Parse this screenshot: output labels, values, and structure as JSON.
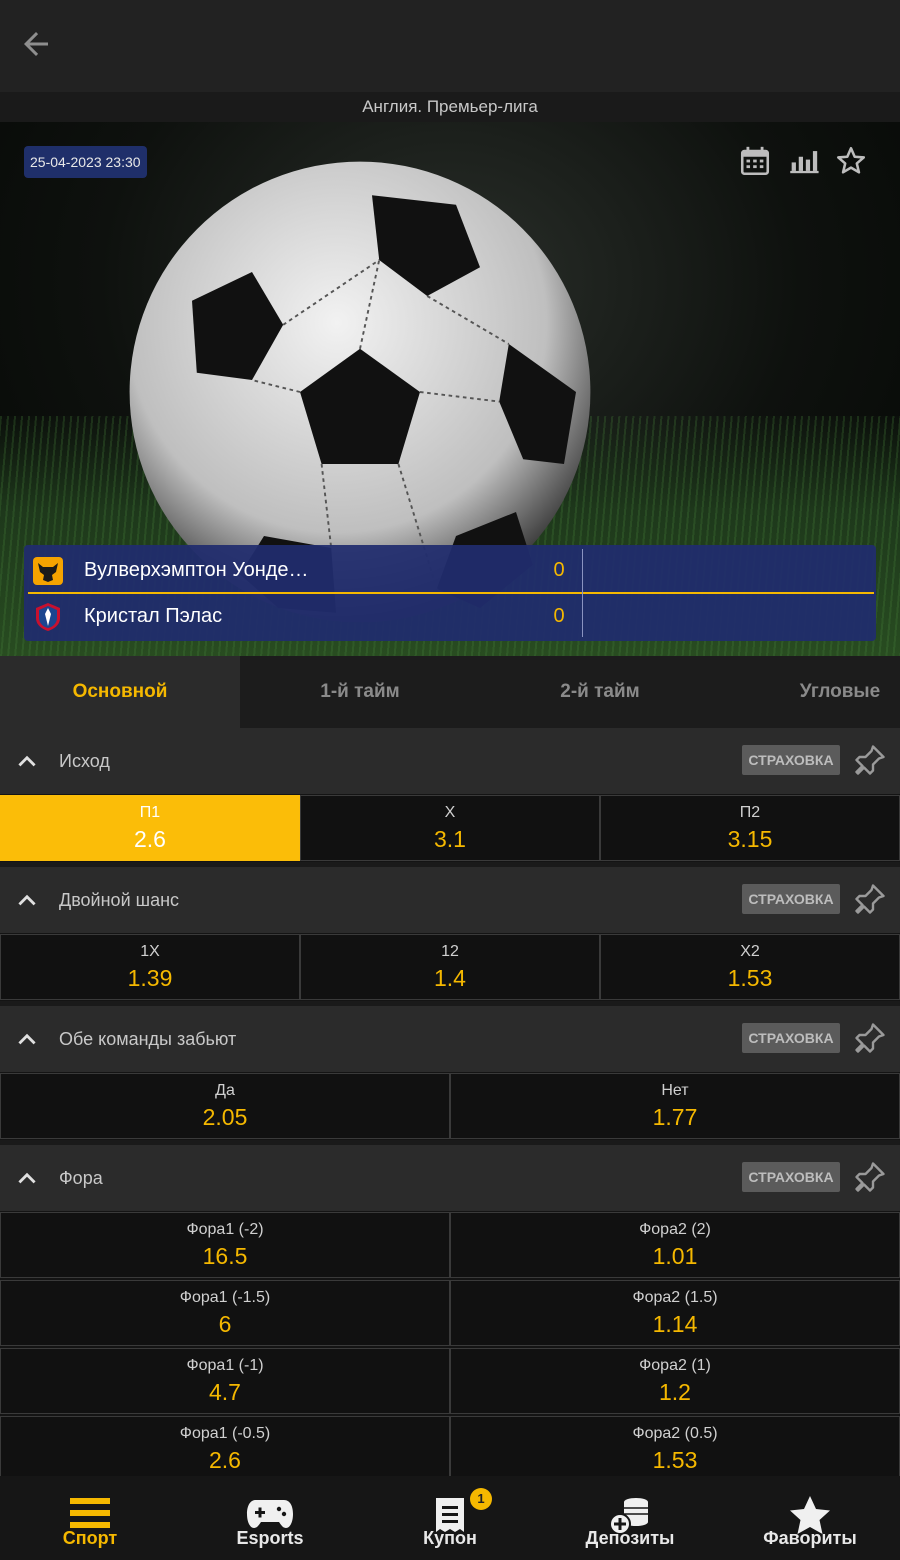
{
  "header": {
    "league": "Англия. Премьер-лига"
  },
  "event": {
    "datetime": "25-04-2023 23:30",
    "teams": [
      {
        "name": "Вулверхэмптон Уонде…",
        "score": "0"
      },
      {
        "name": "Кристал Пэлас",
        "score": "0"
      }
    ]
  },
  "tabs": [
    "Основной",
    "1-й тайм",
    "2-й тайм",
    "Угловые"
  ],
  "insurance_label": "СТРАХОВКА",
  "markets": [
    {
      "title": "Исход",
      "rows": [
        [
          {
            "label": "П1",
            "odd": "2.6"
          },
          {
            "label": "Х",
            "odd": "3.1"
          },
          {
            "label": "П2",
            "odd": "3.15"
          }
        ]
      ]
    },
    {
      "title": "Двойной шанс",
      "rows": [
        [
          {
            "label": "1Х",
            "odd": "1.39"
          },
          {
            "label": "12",
            "odd": "1.4"
          },
          {
            "label": "Х2",
            "odd": "1.53"
          }
        ]
      ]
    },
    {
      "title": "Обе команды забьют",
      "rows": [
        [
          {
            "label": "Да",
            "odd": "2.05"
          },
          {
            "label": "Нет",
            "odd": "1.77"
          }
        ]
      ]
    },
    {
      "title": "Фора",
      "rows": [
        [
          {
            "label": "Фора1 (-2)",
            "odd": "16.5"
          },
          {
            "label": "Фора2 (2)",
            "odd": "1.01"
          }
        ],
        [
          {
            "label": "Фора1 (-1.5)",
            "odd": "6"
          },
          {
            "label": "Фора2 (1.5)",
            "odd": "1.14"
          }
        ],
        [
          {
            "label": "Фора1 (-1)",
            "odd": "4.7"
          },
          {
            "label": "Фора2 (1)",
            "odd": "1.2"
          }
        ],
        [
          {
            "label": "Фора1 (-0.5)",
            "odd": "2.6"
          },
          {
            "label": "Фора2 (0.5)",
            "odd": "1.53"
          }
        ]
      ]
    }
  ],
  "bottom_nav": [
    {
      "label": "Спорт"
    },
    {
      "label": "Esports"
    },
    {
      "label": "Купон",
      "badge": "1"
    },
    {
      "label": "Депозиты"
    },
    {
      "label": "Фавориты"
    }
  ],
  "colors": {
    "accent": "#f5b800",
    "scoreboard": "#202c6e",
    "background": "#1a1a1a"
  }
}
